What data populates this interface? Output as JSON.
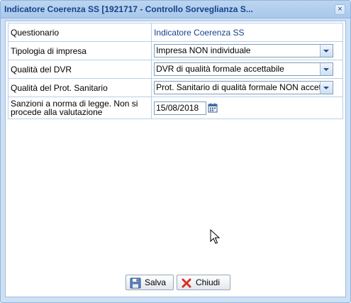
{
  "window": {
    "title": "Indicatore Coerenza SS [1921717 - Controllo Sorveglianza S...",
    "close_glyph": "×"
  },
  "form": {
    "rows": [
      {
        "label": "Questionario",
        "value": "Indicatore Coerenza SS"
      },
      {
        "label": "Tipologia di impresa",
        "value": "Impresa NON individuale"
      },
      {
        "label": "Qualità del DVR",
        "value": "DVR di qualità formale accettabile"
      },
      {
        "label": "Qualità del Prot. Sanitario",
        "value": "Prot. Sanitario di qualità formale NON accettabile"
      },
      {
        "label": "Sanzioni a norma di legge. Non si procede alla valutazione",
        "value": "15/08/2018"
      }
    ]
  },
  "buttons": {
    "save_label": "Salva",
    "close_label": "Chiudi"
  },
  "icons": {
    "save": "floppy-disk-icon",
    "close": "red-x-icon",
    "calendar": "calendar-icon",
    "dropdown": "chevron-down-icon"
  },
  "colors": {
    "title_text": "#15428b",
    "title_bar": "#bcd5f0",
    "link_text": "#15428b",
    "border": "#99bbe8",
    "close_x": "#d9301e"
  }
}
